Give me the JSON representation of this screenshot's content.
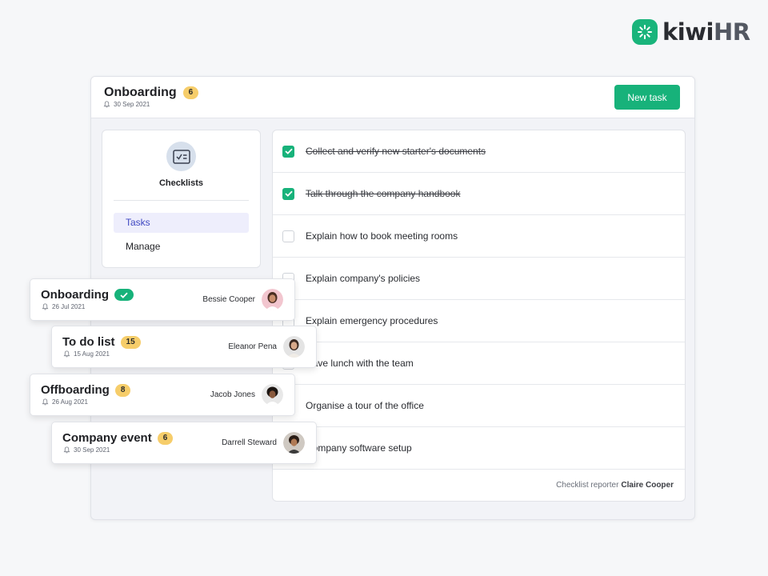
{
  "logo": {
    "part1": "kiwi",
    "part2": "HR",
    "icon": "sun-burst-icon",
    "color": "#19b47b"
  },
  "header": {
    "title": "Onboarding",
    "count": "6",
    "date": "30 Sep 2021",
    "new_task_label": "New task"
  },
  "sidebar": {
    "title": "Checklists",
    "icon": "checklist-icon",
    "items": [
      {
        "label": "Tasks",
        "active": true
      },
      {
        "label": "Manage",
        "active": false
      }
    ]
  },
  "tasks": [
    {
      "label": "Collect and verify new starter's documents",
      "done": true
    },
    {
      "label": "Talk through the company handbook",
      "done": true
    },
    {
      "label": "Explain how to book meeting rooms",
      "done": false
    },
    {
      "label": "Explain company's policies",
      "done": false
    },
    {
      "label": "Explain emergency procedures",
      "done": false
    },
    {
      "label": "Have lunch with the team",
      "done": false
    },
    {
      "label": "Organise a tour of the office",
      "done": false
    },
    {
      "label": "Company software setup",
      "done": false
    }
  ],
  "reporter": {
    "label": "Checklist reporter",
    "name": "Claire Cooper"
  },
  "checklists": [
    {
      "title": "Onboarding",
      "badge_type": "check",
      "count": "",
      "date": "26 Jul 2021",
      "person": "Bessie Cooper"
    },
    {
      "title": "To do list",
      "badge_type": "count",
      "count": "15",
      "date": "15 Aug 2021",
      "person": "Eleanor Pena"
    },
    {
      "title": "Offboarding",
      "badge_type": "count",
      "count": "8",
      "date": "26 Aug 2021",
      "person": "Jacob Jones"
    },
    {
      "title": "Company event",
      "badge_type": "count",
      "count": "6",
      "date": "30 Sep 2021",
      "person": "Darrell Steward"
    }
  ],
  "colors": {
    "accent_green": "#17b27a",
    "badge_yellow": "#f6cd6a",
    "active_nav_bg": "#eeeefc",
    "active_nav_text": "#3f48c2"
  }
}
